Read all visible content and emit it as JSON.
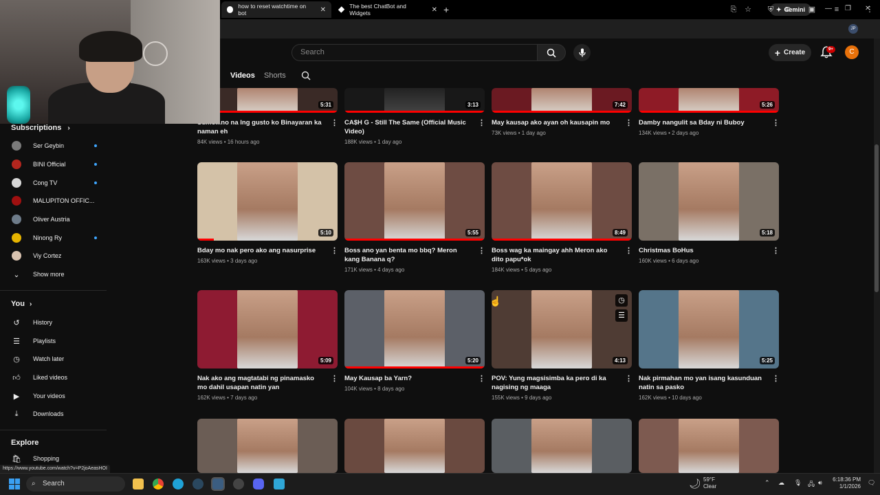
{
  "browser": {
    "tabs": [
      {
        "title": "how to reset watchtime on bot"
      },
      {
        "title": "The best ChatBot and Widgets"
      }
    ],
    "gemini_label": "Gemini",
    "status_url": "https://www.youtube.com/watch?v=P2joAeasHOI",
    "profile_initials": "JP"
  },
  "yt": {
    "search_placeholder": "Search",
    "create_label": "Create",
    "notif_count": "9+",
    "user_initial": "C",
    "channel_tabs": [
      "Videos",
      "Shorts"
    ]
  },
  "sidebar": {
    "subscriptions_header": "Subscriptions",
    "subscriptions": [
      {
        "name": "Ser Geybin",
        "color": "#7a7a7a",
        "dot": true
      },
      {
        "name": "BINI Official",
        "color": "#b3261e",
        "dot": true
      },
      {
        "name": "Cong TV",
        "color": "#d8d8d8",
        "dot": true
      },
      {
        "name": "MALUPITON OFFIC...",
        "color": "#a01010",
        "dot": false
      },
      {
        "name": "Oliver Austria",
        "color": "#6e7c8a",
        "dot": false
      },
      {
        "name": "Ninong Ry",
        "color": "#e6b400",
        "dot": true
      },
      {
        "name": "Viy Cortez",
        "color": "#d9c3b0",
        "dot": false
      }
    ],
    "show_more": "Show more",
    "you_header": "You",
    "you_items": [
      {
        "label": "History",
        "icon": "history-icon"
      },
      {
        "label": "Playlists",
        "icon": "playlists-icon"
      },
      {
        "label": "Watch later",
        "icon": "watch-later-icon"
      },
      {
        "label": "Liked videos",
        "icon": "liked-icon"
      },
      {
        "label": "Your videos",
        "icon": "your-videos-icon"
      },
      {
        "label": "Downloads",
        "icon": "downloads-icon"
      }
    ],
    "explore_header": "Explore",
    "explore_items": [
      {
        "label": "Shopping",
        "icon": "shopping-icon"
      }
    ]
  },
  "videos": [
    {
      "title": "Sumo...no na lng gusto ko Binayaran ka naman eh",
      "views": "84K views",
      "age": "16 hours ago",
      "duration": "5:31",
      "bg": "#3a2a26"
    },
    {
      "title": "CA$H G - Still The Same (Official Music Video)",
      "views": "188K views",
      "age": "1 day ago",
      "duration": "3:13",
      "bg": "#181818"
    },
    {
      "title": "May kausap ako ayan oh kausapin mo",
      "views": "73K views",
      "age": "1 day ago",
      "duration": "7:42",
      "bg": "#6b1a22"
    },
    {
      "title": "Damby nangulit sa Bday ni Buboy",
      "views": "134K views",
      "age": "2 days ago",
      "duration": "5:26",
      "bg": "#8e1b26"
    },
    {
      "title": "Bday mo nak pero ako ang nasurprise",
      "views": "163K views",
      "age": "3 days ago",
      "duration": "5:10",
      "bg": "#d4c2a8"
    },
    {
      "title": "Boss ano yan benta mo bbq? Meron kang Banana q?",
      "views": "171K views",
      "age": "4 days ago",
      "duration": "5:55",
      "bg": "#6e4c43"
    },
    {
      "title": "Boss wag ka maingay ahh Meron ako dito papu*ok",
      "views": "184K views",
      "age": "5 days ago",
      "duration": "8:49",
      "bg": "#6e4c43"
    },
    {
      "title": "Christmas BoHus",
      "views": "160K views",
      "age": "6 days ago",
      "duration": "5:18",
      "bg": "#7a7066"
    },
    {
      "title": "Nak ako ang magtatabi ng pinamasko mo dahil usapan natin yan",
      "views": "162K views",
      "age": "7 days ago",
      "duration": "5:09",
      "bg": "#8e1b32"
    },
    {
      "title": "May Kausap ba Yarn?",
      "views": "104K views",
      "age": "8 days ago",
      "duration": "5:20",
      "bg": "#5c6068"
    },
    {
      "title": "POV: Yung magsisimba ka pero di ka nagising ng maaga",
      "views": "155K views",
      "age": "9 days ago",
      "duration": "4:13",
      "bg": "#4f3c34"
    },
    {
      "title": "Nak pirmahan mo yan isang kasunduan natin sa pasko",
      "views": "162K views",
      "age": "10 days ago",
      "duration": "5:25",
      "bg": "#55758a"
    },
    {
      "title": "",
      "views": "",
      "age": "",
      "duration": "",
      "bg": "#6b5d55"
    },
    {
      "title": "",
      "views": "",
      "age": "",
      "duration": "",
      "bg": "#6a4a40"
    },
    {
      "title": "",
      "views": "",
      "age": "",
      "duration": "",
      "bg": "#5a5e62"
    },
    {
      "title": "",
      "views": "",
      "age": "",
      "duration": "",
      "bg": "#7d5a50"
    }
  ],
  "taskbar": {
    "search_label": "Search",
    "weather_temp": "59°F",
    "weather_desc": "Clear",
    "time": "6:18:36 PM",
    "date": "1/1/2026"
  }
}
